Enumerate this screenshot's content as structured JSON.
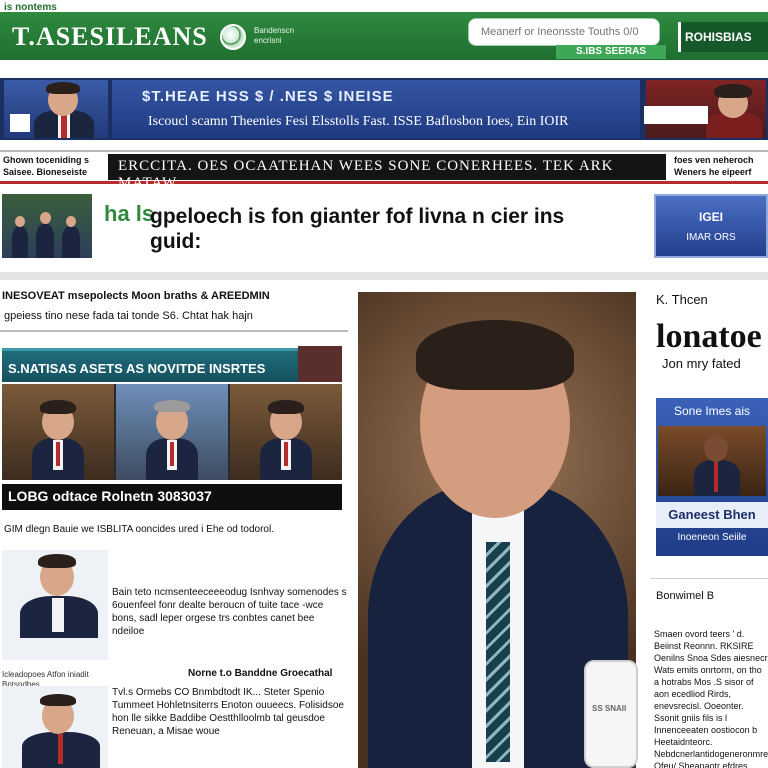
{
  "header": {
    "top_tag": "is nontems",
    "brand": "T.ASESILEANS",
    "subbrand": "Bandenscn encrisni",
    "search_placeholder": "Meanerf or Ineonsste Touths 0/0",
    "search_button": "S.IBS SEERAS",
    "right_brand": "ROHISBIAS"
  },
  "banner": {
    "top_text": "$T.HEAE HSS $ / .NES $ INEISE",
    "bottom_text": "Iscoucl scamn Theenies Fesi Elsstolls Fast. ISSE Baflosbon Ioes, Ein IOIR"
  },
  "ticker": {
    "left_text": "Ghown toceniding s Saisee. Bioneseiste",
    "main_text": "ERCCITA. OES OCAATEHAN WEES SONE CONERHEES. TEK ARK MATAW",
    "right_text": "foes ven neheroch Weners he eipeerf"
  },
  "headline": {
    "green_tag": "ha ls",
    "title_line1": "gpeloech is fon gianter fof livna n cier ins",
    "title_line2": "guid:",
    "side_box_line1": "IGEI",
    "side_box_line2": "IMAR ORS"
  },
  "left": {
    "heading": "INESOVEAT msepolects Moon braths & AREEDMIN",
    "subheading": "gpeiess tino nese fada tai tonde S6. Chtat hak hajn",
    "teal_banner": "S.NATISAS ASETS AS NOVITDE INSRTES",
    "caption": "LOBG odtace Rolnetn 3083037",
    "meta": "GIM dlegn Bauie we ISBLITA ooncides ured i Ehe od todorol.",
    "story1_text": "Bain teto ncmsenteeceeeodug Isnhvay somenodes s 6ouenfeel fonr dealte beroucn of tuite tace -wce bons, sadl leper orgese trs conbtes canet bee ndeiloe",
    "story2_small": "Icleadopoes Atfon iniadit Bntsndbes",
    "story2_title": "Norne t.o Banddne Groecathal",
    "story2_text": "Tvl.s Ormebs CO Bnmbdtodt IK... Steter Spenio Tummeet Hohletnsiterrs Enoton ouueecs. Folisidsoe hon lle sikke Baddibe Oestthlloolmb tal geusdoe Reneuan, a Misae woue"
  },
  "center": {
    "phone_text": "SS SNAII"
  },
  "right": {
    "small": "K. Thcen",
    "big": "lonatoe",
    "sub": "Jon mry fated",
    "promo_title": "Sone Imes ais",
    "promo_caption": "Ganeest Bhen",
    "promo_sub": "Inoeneon Seiile",
    "section_head": "Bonwimel B",
    "body": "Smaen ovord teers ' d. Beiinst Reonnn. RKSIRE Oenilns Snoa Sdes aiesnecr Wats emits onrtorm, on tho a hotrabs Mos .S sisor of aon ecedliod Rirds, enevsrecisl. Ooeonter. Ssonit gniis fils is l Innenceeaten oostiocon b Heetaidnteorc. Nebdcnerlantidogeneronmre Ofeu/ Sheanaotr efdres"
  },
  "colors": {
    "green": "#2f8a3f",
    "navy": "#1c2f63",
    "teal": "#1f6c7c",
    "red_accent": "#b52a2a"
  }
}
